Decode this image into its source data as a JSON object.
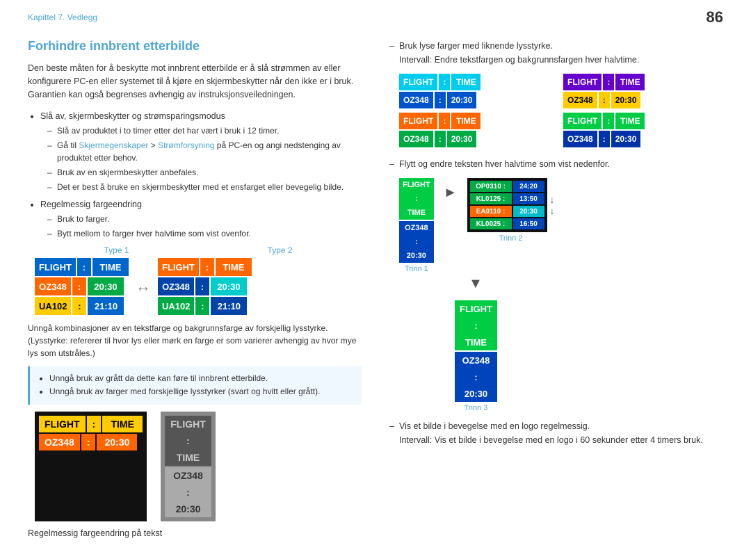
{
  "header": {
    "chapter_label": "Kapittel 7. Vedlegg",
    "page_number": "86"
  },
  "section": {
    "title": "Forhindre innbrent etterbilde",
    "intro": "Den beste måten for å beskytte mot innbrent etterbilde er å slå strømmen av eller konfigurere PC-en eller systemet til å kjøre en skjermbeskytter når den ikke er i bruk. Garantien kan også begrenses avhengig av instruksjonsveiledningen.",
    "bullets": [
      {
        "text": "Slå av, skjermbeskytter og strømsparingsmodus",
        "sub": [
          "Slå av produktet i to timer etter det har vært i bruk i 12 timer.",
          "Gå til Skjermegenskaper > Strømforsyning på PC-en og angi nedstenging av produktet etter behov.",
          "Bruk av en skjermbeskytter anbefales.",
          "Det er best å bruke en skjermbeskytter med et ensfarget eller bevegelig bilde."
        ]
      },
      {
        "text": "Regelmessig fargeendring",
        "sub": [
          "Bruk to farger.",
          "Bytt mellom to farger hver halvtime som vist ovenfor."
        ]
      }
    ],
    "type1_label": "Type 1",
    "type2_label": "Type 2",
    "board1": {
      "header": [
        "FLIGHT",
        ":",
        "TIME"
      ],
      "rows": [
        [
          "OZ348",
          ":",
          "20:30"
        ],
        [
          "UA102",
          ":",
          "21:10"
        ]
      ]
    },
    "board2": {
      "header": [
        "FLIGHT",
        ":",
        "TIME"
      ],
      "rows": [
        [
          "OZ348",
          ":",
          "20:30"
        ],
        [
          "UA102",
          ":",
          "21:10"
        ]
      ]
    },
    "avoid_text": "Unngå kombinasjoner av en tekstfarge og bakgrunnsfarge av forskjellig lysstyrke. (Lysstyrke: refererer til hvor lys eller mørk en farge er som varierer avhengig av hvor mye lys som utstråles.)",
    "note_items": [
      "Unngå bruk av grått da dette kan føre til innbrent etterbilde.",
      "Unngå bruk av farger med forskjellige lysstyrker (svart og hvitt eller grått)."
    ],
    "dark_board": {
      "header": [
        "FLIGHT",
        ":",
        "TIME"
      ],
      "row": [
        "OZ348",
        ":",
        "20:30"
      ]
    },
    "gray_board": {
      "header": [
        "FLIGHT",
        ":",
        "TIME"
      ],
      "row": [
        "OZ348",
        ":",
        "20:30"
      ]
    },
    "bottom_label": "Regelmessig fargeendring på tekst"
  },
  "right": {
    "bullets": [
      {
        "text": "Bruk lyse farger med liknende lysstyrke.",
        "sub": "Intervall: Endre tekstfargen og bakgrunnsfargen hver halvtime."
      },
      {
        "text": "Flytt og endre teksten hver halvtime som vist nedenfor.",
        "sub": ""
      },
      {
        "text": "Vis et bilde i bevegelse med en logo regelmessig.",
        "sub": "Intervall: Vis et bilde i bevegelse med en logo i 60 sekunder etter 4 timers bruk."
      }
    ],
    "boards_2x2": [
      {
        "header_color": "cyan",
        "body_color": "blue",
        "header": [
          "FLIGHT",
          ":",
          "TIME"
        ],
        "row": [
          "OZ348",
          ":",
          "20:30"
        ]
      },
      {
        "header_color": "purple",
        "body_color": "yellow",
        "header": [
          "FLIGHT",
          ":",
          "TIME"
        ],
        "row": [
          "OZ348",
          ":",
          "20:30"
        ]
      },
      {
        "header_color": "orange",
        "body_color": "green",
        "header": [
          "FLIGHT",
          ":",
          "TIME"
        ],
        "row": [
          "OZ348",
          ":",
          "20:30"
        ]
      },
      {
        "header_color": "green2",
        "body_color": "blue2",
        "header": [
          "FLIGHT",
          ":",
          "TIME"
        ],
        "row": [
          "OZ348",
          ":",
          "20:30"
        ]
      }
    ],
    "trinn1_label": "Trinn 1",
    "trinn2_label": "Trinn 2",
    "trinn3_label": "Trinn 3",
    "step1_header": [
      "FLIGHT",
      ":",
      "TIME"
    ],
    "step1_row": [
      "OZ348",
      ":",
      "20:30"
    ],
    "step2_rows": [
      [
        "OP0310 :",
        "24:20"
      ],
      [
        "KL0125 :",
        "13:50"
      ],
      [
        "EA0110 :",
        "20:30"
      ],
      [
        "KL0025 :",
        "16:50"
      ]
    ],
    "step3_header": [
      "FLIGHT",
      ":",
      "TIME"
    ],
    "step3_row": [
      "OZ348",
      ":",
      "20:30"
    ]
  }
}
